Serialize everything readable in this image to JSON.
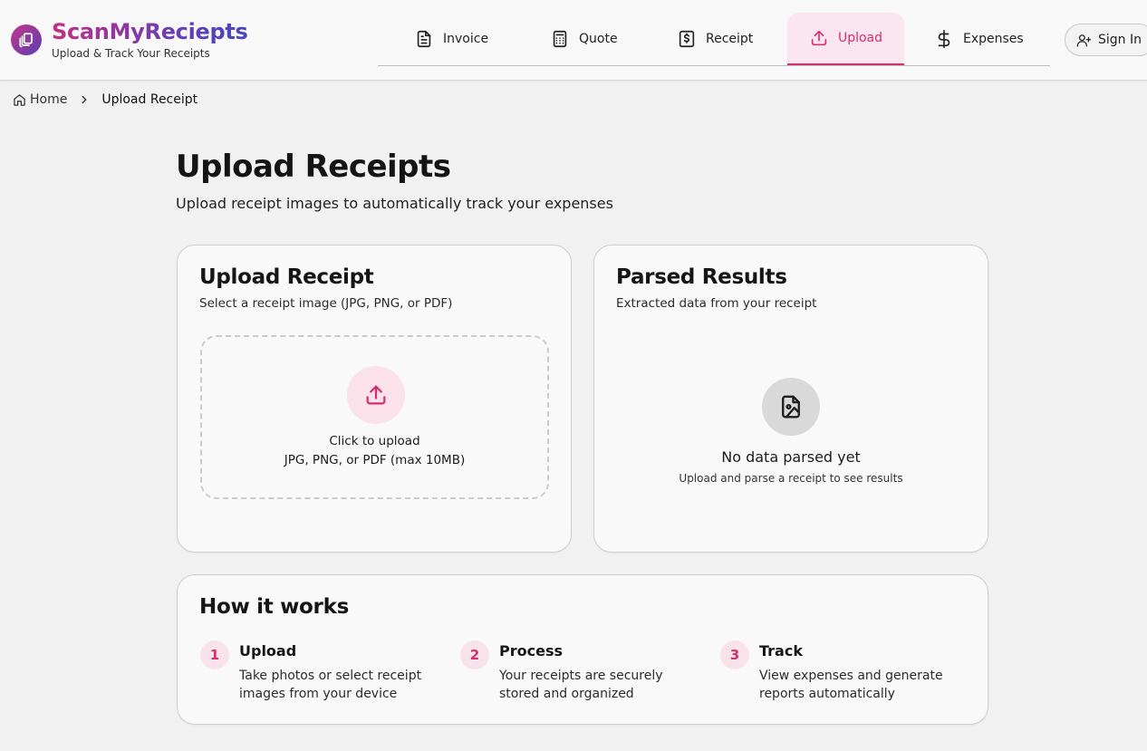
{
  "brand": {
    "name": "ScanMyReciepts",
    "tagline": "Upload & Track Your Receipts"
  },
  "nav": {
    "items": [
      {
        "label": "Invoice",
        "icon": "document-icon"
      },
      {
        "label": "Quote",
        "icon": "calculator-icon"
      },
      {
        "label": "Receipt",
        "icon": "dollar-receipt-icon"
      },
      {
        "label": "Upload",
        "icon": "upload-icon",
        "active": true
      },
      {
        "label": "Expenses",
        "icon": "dollar-icon"
      }
    ],
    "sign_in": "Sign In"
  },
  "breadcrumb": {
    "home": "Home",
    "current": "Upload Receipt"
  },
  "page": {
    "title": "Upload Receipts",
    "subtitle": "Upload receipt images to automatically track your expenses"
  },
  "upload_card": {
    "title": "Upload Receipt",
    "subtitle": "Select a receipt image (JPG, PNG, or PDF)",
    "drop_line1": "Click to upload",
    "drop_line2": "JPG, PNG, or PDF (max 10MB)"
  },
  "results_card": {
    "title": "Parsed Results",
    "subtitle": "Extracted data from your receipt",
    "empty_title": "No data parsed yet",
    "empty_subtitle": "Upload and parse a receipt to see results"
  },
  "how_it_works": {
    "title": "How it works",
    "steps": [
      {
        "num": "1",
        "title": "Upload",
        "desc": "Take photos or select receipt images from your device"
      },
      {
        "num": "2",
        "title": "Process",
        "desc": "Your receipts are securely stored and organized"
      },
      {
        "num": "3",
        "title": "Track",
        "desc": "View expenses and generate reports automatically"
      }
    ]
  },
  "colors": {
    "accent": "#d0306f",
    "accent_soft": "#fae1ea",
    "brand_purple": "#5e40b8"
  }
}
